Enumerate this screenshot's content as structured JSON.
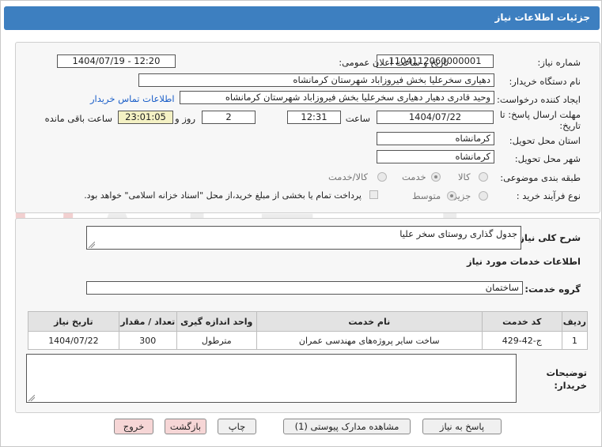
{
  "header": {
    "title": "جزئیات اطلاعات نیاز"
  },
  "form": {
    "need_number_label": "شماره نیاز:",
    "need_number": "1104112060000001",
    "announce_label": "تاریخ و ساعت اعلان عمومی:",
    "announce_value": "1404/07/19 - 12:20",
    "buyer_org_label": "نام دستگاه خریدار:",
    "buyer_org": "دهیاری سخرعلیا بخش فیروزاباد شهرستان کرمانشاه",
    "creator_label": "ایجاد کننده درخواست:",
    "creator": "وحید قادری دهیار دهیاری سخرعلیا بخش فیروزاباد شهرستان کرمانشاه",
    "contact_link": "اطلاعات تماس خریدار",
    "deadline_label_1": "مهلت ارسال پاسخ: تا",
    "deadline_label_2": "تاریخ:",
    "deadline_date": "1404/07/22",
    "time_label": "ساعت",
    "deadline_time": "12:31",
    "days_value": "2",
    "days_label": "روز و",
    "remaining_time": "23:01:05",
    "remaining_label": "ساعت باقی مانده",
    "province_label": "استان محل تحویل:",
    "province": "کرمانشاه",
    "city_label": "شهر محل تحویل:",
    "city": "کرمانشاه",
    "category_label": "طبقه بندی موضوعی:",
    "category_options": [
      "کالا",
      "خدمت",
      "کالا/خدمت"
    ],
    "purchase_type_label": "نوع فرآیند خرید :",
    "purchase_options": [
      "جزیی",
      "متوسط"
    ],
    "payment_note": "پرداخت تمام یا بخشی از مبلغ خرید،از محل \"اسناد خزانه اسلامی\" خواهد بود."
  },
  "summary": {
    "label": "شرح کلی نیاز:",
    "value": "جدول گذاری روستای سخر علیا",
    "services_title": "اطلاعات خدمات مورد نیاز",
    "group_label": "گروه خدمت:",
    "group_value": "ساختمان"
  },
  "table": {
    "headers": [
      "ردیف",
      "کد خدمت",
      "نام خدمت",
      "واحد اندازه گیری",
      "تعداد / مقدار",
      "تاریخ نیاز"
    ],
    "rows": [
      [
        "1",
        "ج-42-429",
        "ساخت سایر پروژه‌های مهندسی عمران",
        "مترطول",
        "300",
        "1404/07/22"
      ]
    ]
  },
  "notes": {
    "label_1": "توضیحات",
    "label_2": "خریدار:"
  },
  "buttons": {
    "reply": "پاسخ به نیاز",
    "attachments": "مشاهده مدارک پیوستی (1)",
    "print": "چاپ",
    "back": "بازگشت",
    "exit": "خروج"
  },
  "watermark_text": "AriaTender.neT",
  "colors": {
    "header": "#3d7fc0",
    "link": "#1a5ec8",
    "remaining_bg": "#f4f1c4",
    "pink_button": "#f6d6d6"
  }
}
